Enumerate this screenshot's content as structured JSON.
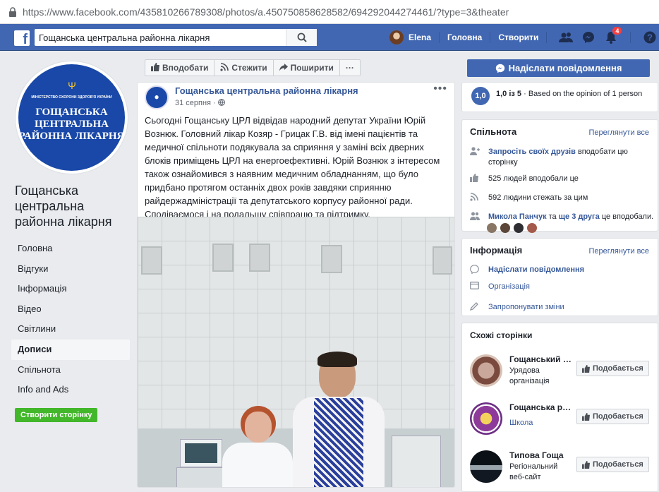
{
  "browser": {
    "url": "https://www.facebook.com/435810266789308/photos/a.450750858628582/694292044274461/?type=3&theater"
  },
  "topbar": {
    "search_value": "Гощанська центральна районна лікарня",
    "user_name": "Elena",
    "nav_home": "Головна",
    "nav_create": "Створити",
    "notifications_count": "4"
  },
  "sidebar": {
    "profile_sign_small": "МІНІСТЕРСТВО ОХОРОНИ ЗДОРОВ'Я УКРАЇНИ",
    "profile_sign_big": "ГОЩАНСЬКА ЦЕНТРАЛЬНА РАЙОННА ЛІКАРНЯ",
    "page_name": "Гощанська центральна районна лікарня",
    "items": [
      {
        "label": "Головна"
      },
      {
        "label": "Відгуки"
      },
      {
        "label": "Інформація"
      },
      {
        "label": "Відео"
      },
      {
        "label": "Світлини"
      },
      {
        "label": "Дописи"
      },
      {
        "label": "Спільнота"
      },
      {
        "label": "Info and Ads"
      }
    ],
    "create_page_label": "Створити сторінку"
  },
  "actions": {
    "like": "Вподобати",
    "follow": "Стежити",
    "share": "Поширити",
    "more": "···",
    "send_message": "Надіслати повідомлення"
  },
  "post": {
    "author": "Гощанська центральна районна лікарня",
    "date": "31 серпня",
    "text": "Сьогодні Гощанську ЦРЛ відвідав народний депутат України Юрій Вознюк. Головний лікар Козяр - Грицак Г.В. від імені пацієнтів та медичної спільноти подякувала за сприяння у заміні всіх дверних блоків приміщень ЦРЛ на енергоефективні. Юрій Вознюк з інтересом також ознайомився з наявним медичним обладнанням, що було придбано протягом останніх двох років завдяки сприянню райдержадміністрації та депутатського корпусу районної ради. Сподіваємося і на подальшу співпрацю та підтримку."
  },
  "rating": {
    "value": "1,0",
    "text_value": "1,0 із 5",
    "text_rest": "Based on the opinion of 1 person"
  },
  "community": {
    "title": "Спільнота",
    "see_all": "Переглянути все",
    "invite_link": "Запросіть своїх друзів",
    "invite_rest": "вподобати цю сторінку",
    "likes": "525 людей вподобали це",
    "follows": "592 людини стежать за цим",
    "friend_name": "Микола Панчук",
    "friend_and": "та",
    "friend_more": "ще 3 друга",
    "friend_rest": "це вподобали."
  },
  "info": {
    "title": "Інформація",
    "see_all": "Переглянути все",
    "message": "Надіслати повідомлення",
    "category": "Організація",
    "suggest": "Запропонувати зміни"
  },
  "similar": {
    "title": "Схожі сторінки",
    "like_label": "Подобається",
    "pages": [
      {
        "name": "Гощанський …",
        "category": "Урядова організація"
      },
      {
        "name": "Гощанська р…",
        "category": "Школа"
      },
      {
        "name": "Типова Гоща",
        "category": "Регіональний веб-сайт"
      }
    ]
  },
  "colors": {
    "fb_blue": "#4267b2",
    "link": "#365899",
    "green": "#42b72a"
  }
}
